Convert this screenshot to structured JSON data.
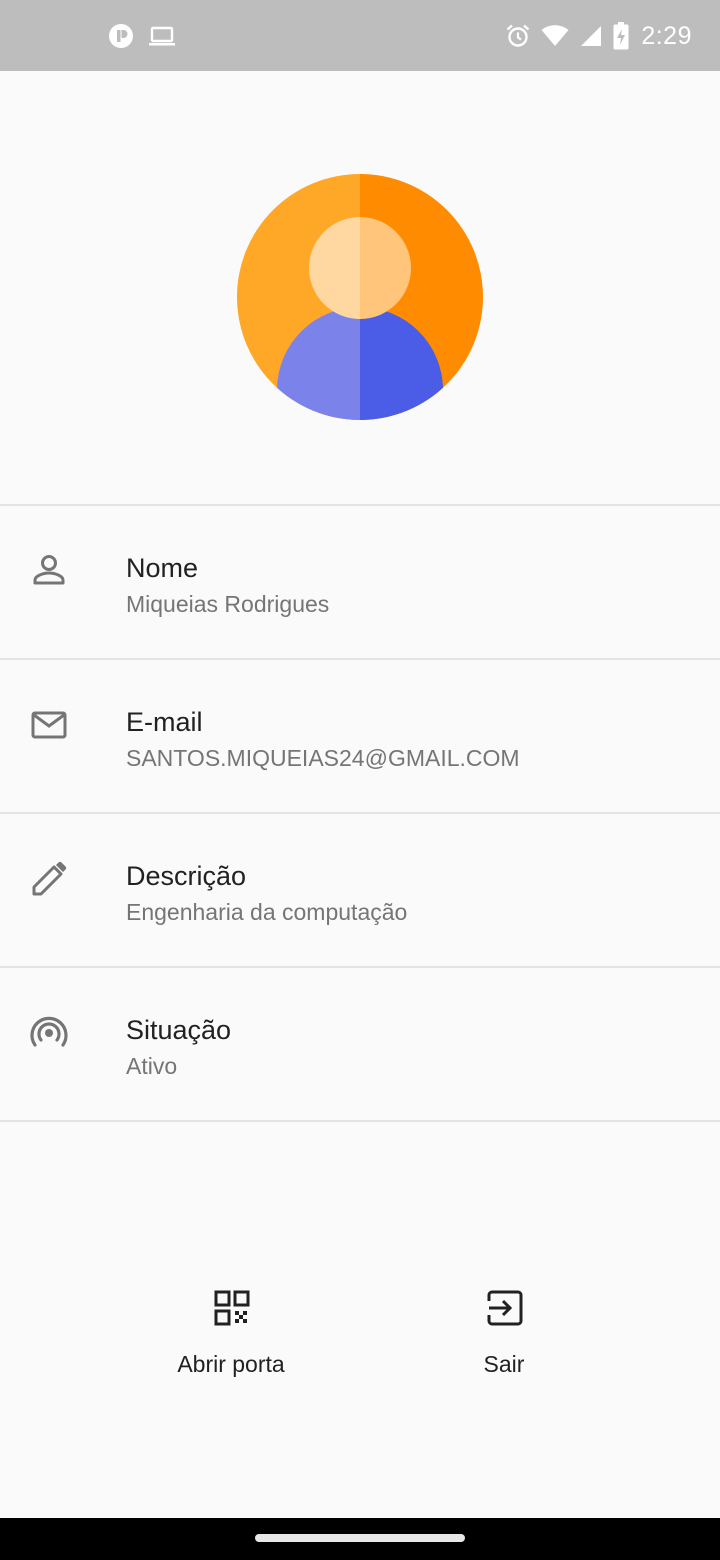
{
  "status_bar": {
    "time": "2:29",
    "left_icons": [
      "app-notification-icon",
      "laptop-icon"
    ],
    "right_icons": [
      "alarm-icon",
      "wifi-icon",
      "signal-icon",
      "battery-charging-icon"
    ]
  },
  "profile": {
    "avatar_icon": "person-avatar-icon",
    "items": [
      {
        "icon": "person-icon",
        "title": "Nome",
        "value": "Miqueias Rodrigues"
      },
      {
        "icon": "mail-icon",
        "title": "E-mail",
        "value": "SANTOS.MIQUEIAS24@GMAIL.COM"
      },
      {
        "icon": "pencil-icon",
        "title": "Descrição",
        "value": "Engenharia da computação"
      },
      {
        "icon": "signal-broadcast-icon",
        "title": "Situação",
        "value": "Ativo"
      }
    ]
  },
  "actions": {
    "open_door": {
      "icon": "qr-code-icon",
      "label": "Abrir porta"
    },
    "exit": {
      "icon": "exit-icon",
      "label": "Sair"
    }
  },
  "colors": {
    "status_bar_bg": "#bdbdbd",
    "background": "#fafafa",
    "avatar_orange_light": "#ffa726",
    "avatar_orange_dark": "#ff8c00",
    "avatar_face_light": "#ffd7a0",
    "avatar_face_dark": "#ffc57a",
    "avatar_body_light": "#7b83eb",
    "avatar_body_dark": "#4b5ce6",
    "icon_gray": "#757575"
  }
}
